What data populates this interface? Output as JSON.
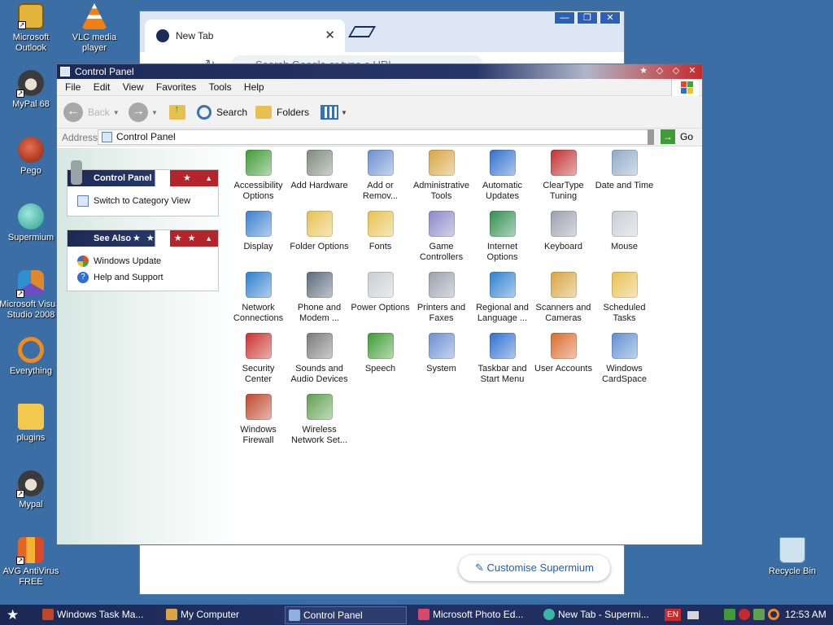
{
  "colors": {
    "desktop": "#3a6ea5",
    "title_bar": "#1c2a55",
    "flag_red": "#b3242b",
    "taskbar": "#1b2854",
    "link_blue": "#1a5fb4"
  },
  "desktop_icons": [
    {
      "label": "Microsoft Outlook",
      "icon": "outlook-icon",
      "color": "#e3b43a"
    },
    {
      "label": "VLC media player",
      "icon": "vlc-cone-icon",
      "color": "#f07f12"
    },
    {
      "label": "MyPal 68",
      "icon": "raccoon-icon",
      "color": "#3b3b3b"
    },
    {
      "label": "Pego",
      "icon": "pego-icon",
      "color": "#b5321f"
    },
    {
      "label": "Supermium",
      "icon": "supermium-icon",
      "color": "#38b7a7"
    },
    {
      "label": "Microsoft Visual Studio 2008",
      "icon": "visual-studio-icon",
      "color": "#e0872b"
    },
    {
      "label": "Everything",
      "icon": "everything-search-icon",
      "color": "#f08a1c"
    },
    {
      "label": "plugins",
      "icon": "folder-icon",
      "color": "#f2c94c"
    },
    {
      "label": "Mypal",
      "icon": "raccoon-icon",
      "color": "#3b3b3b"
    },
    {
      "label": "AVG AntiVirus FREE",
      "icon": "avg-icon",
      "color": "#e0662b"
    },
    {
      "label": "Recycle Bin",
      "icon": "recycle-bin-icon",
      "color": "#cfe3ef"
    }
  ],
  "browser": {
    "tab_title": "New Tab",
    "tab_close": "✕",
    "omnibox_placeholder": "Search Google or type a URL",
    "customise_button": "Customise Supermium",
    "win_min": "—",
    "win_max": "❐",
    "win_close": "✕"
  },
  "control_panel": {
    "title": "Control Panel",
    "menu": [
      "File",
      "Edit",
      "View",
      "Favorites",
      "Tools",
      "Help"
    ],
    "toolbar": {
      "back": "Back",
      "search": "Search",
      "folders": "Folders"
    },
    "address": {
      "label": "Address",
      "value": "Control Panel",
      "go": "Go"
    },
    "task_panels": [
      {
        "title": "Control Panel",
        "items": [
          {
            "label": "Switch to Category View",
            "icon": "category-view-icon"
          }
        ]
      },
      {
        "title": "See Also",
        "items": [
          {
            "label": "Windows Update",
            "icon": "windows-update-icon"
          },
          {
            "label": "Help and Support",
            "icon": "help-icon"
          }
        ]
      }
    ],
    "items": [
      {
        "label": "Accessibility Options",
        "icon": "accessibility-icon",
        "color": "#3f9b35"
      },
      {
        "label": "Add Hardware",
        "icon": "add-hardware-icon",
        "color": "#7a8a7a"
      },
      {
        "label": "Add or Remov...",
        "icon": "add-remove-programs-icon",
        "color": "#6a8fd0"
      },
      {
        "label": "Administrative Tools",
        "icon": "administrative-tools-icon",
        "color": "#d9a441"
      },
      {
        "label": "Automatic Updates",
        "icon": "automatic-updates-icon",
        "color": "#2f6fcf"
      },
      {
        "label": "ClearType Tuning",
        "icon": "cleartype-icon",
        "color": "#c02f2f"
      },
      {
        "label": "Date and Time",
        "icon": "date-time-icon",
        "color": "#8fa9c8"
      },
      {
        "label": "Display",
        "icon": "display-icon",
        "color": "#3a7fd0"
      },
      {
        "label": "Folder Options",
        "icon": "folder-options-icon",
        "color": "#e7c14f"
      },
      {
        "label": "Fonts",
        "icon": "fonts-folder-icon",
        "color": "#e7c14f"
      },
      {
        "label": "Game Controllers",
        "icon": "game-controller-icon",
        "color": "#8a87c8"
      },
      {
        "label": "Internet Options",
        "icon": "internet-options-icon",
        "color": "#2f8f4f"
      },
      {
        "label": "Keyboard",
        "icon": "keyboard-icon",
        "color": "#9aa0ac"
      },
      {
        "label": "Mouse",
        "icon": "mouse-icon",
        "color": "#c9ccd3"
      },
      {
        "label": "Network Connections",
        "icon": "network-icon",
        "color": "#2f7fcf"
      },
      {
        "label": "Phone and Modem ...",
        "icon": "phone-modem-icon",
        "color": "#5a6a7a"
      },
      {
        "label": "Power Options",
        "icon": "power-options-icon",
        "color": "#c9ccd3"
      },
      {
        "label": "Printers and Faxes",
        "icon": "printer-icon",
        "color": "#9aa0ac"
      },
      {
        "label": "Regional and Language ...",
        "icon": "regional-language-icon",
        "color": "#2f7fcf"
      },
      {
        "label": "Scanners and Cameras",
        "icon": "scanner-camera-icon",
        "color": "#d9a441"
      },
      {
        "label": "Scheduled Tasks",
        "icon": "scheduled-tasks-icon",
        "color": "#e7c14f"
      },
      {
        "label": "Security Center",
        "icon": "security-shield-icon",
        "color": "#c9302c"
      },
      {
        "label": "Sounds and Audio Devices",
        "icon": "speaker-icon",
        "color": "#7a7a7a"
      },
      {
        "label": "Speech",
        "icon": "speech-icon",
        "color": "#3f9b35"
      },
      {
        "label": "System",
        "icon": "system-icon",
        "color": "#6a8fd0"
      },
      {
        "label": "Taskbar and Start Menu",
        "icon": "taskbar-icon",
        "color": "#2f6fcf"
      },
      {
        "label": "User Accounts",
        "icon": "user-accounts-icon",
        "color": "#d96a2b"
      },
      {
        "label": "Windows CardSpace",
        "icon": "cardspace-icon",
        "color": "#5f8fd0"
      },
      {
        "label": "Windows Firewall",
        "icon": "firewall-icon",
        "color": "#c0462b"
      },
      {
        "label": "Wireless Network Set...",
        "icon": "wireless-setup-icon",
        "color": "#5fa04f"
      }
    ]
  },
  "taskbar": {
    "buttons": [
      {
        "label": "Windows Task Ma...",
        "icon": "task-manager-icon",
        "color": "#c0462b"
      },
      {
        "label": "My Computer",
        "icon": "my-computer-icon",
        "color": "#d9a441"
      },
      {
        "label": "Control Panel",
        "icon": "control-panel-icon",
        "color": "#8fb0e0"
      },
      {
        "label": "Microsoft Photo Ed...",
        "icon": "photo-editor-icon",
        "color": "#d9476b"
      },
      {
        "label": "New Tab - Supermi...",
        "icon": "supermium-icon",
        "color": "#38b7a7"
      }
    ],
    "language": "EN",
    "clock": "12:53 AM"
  }
}
